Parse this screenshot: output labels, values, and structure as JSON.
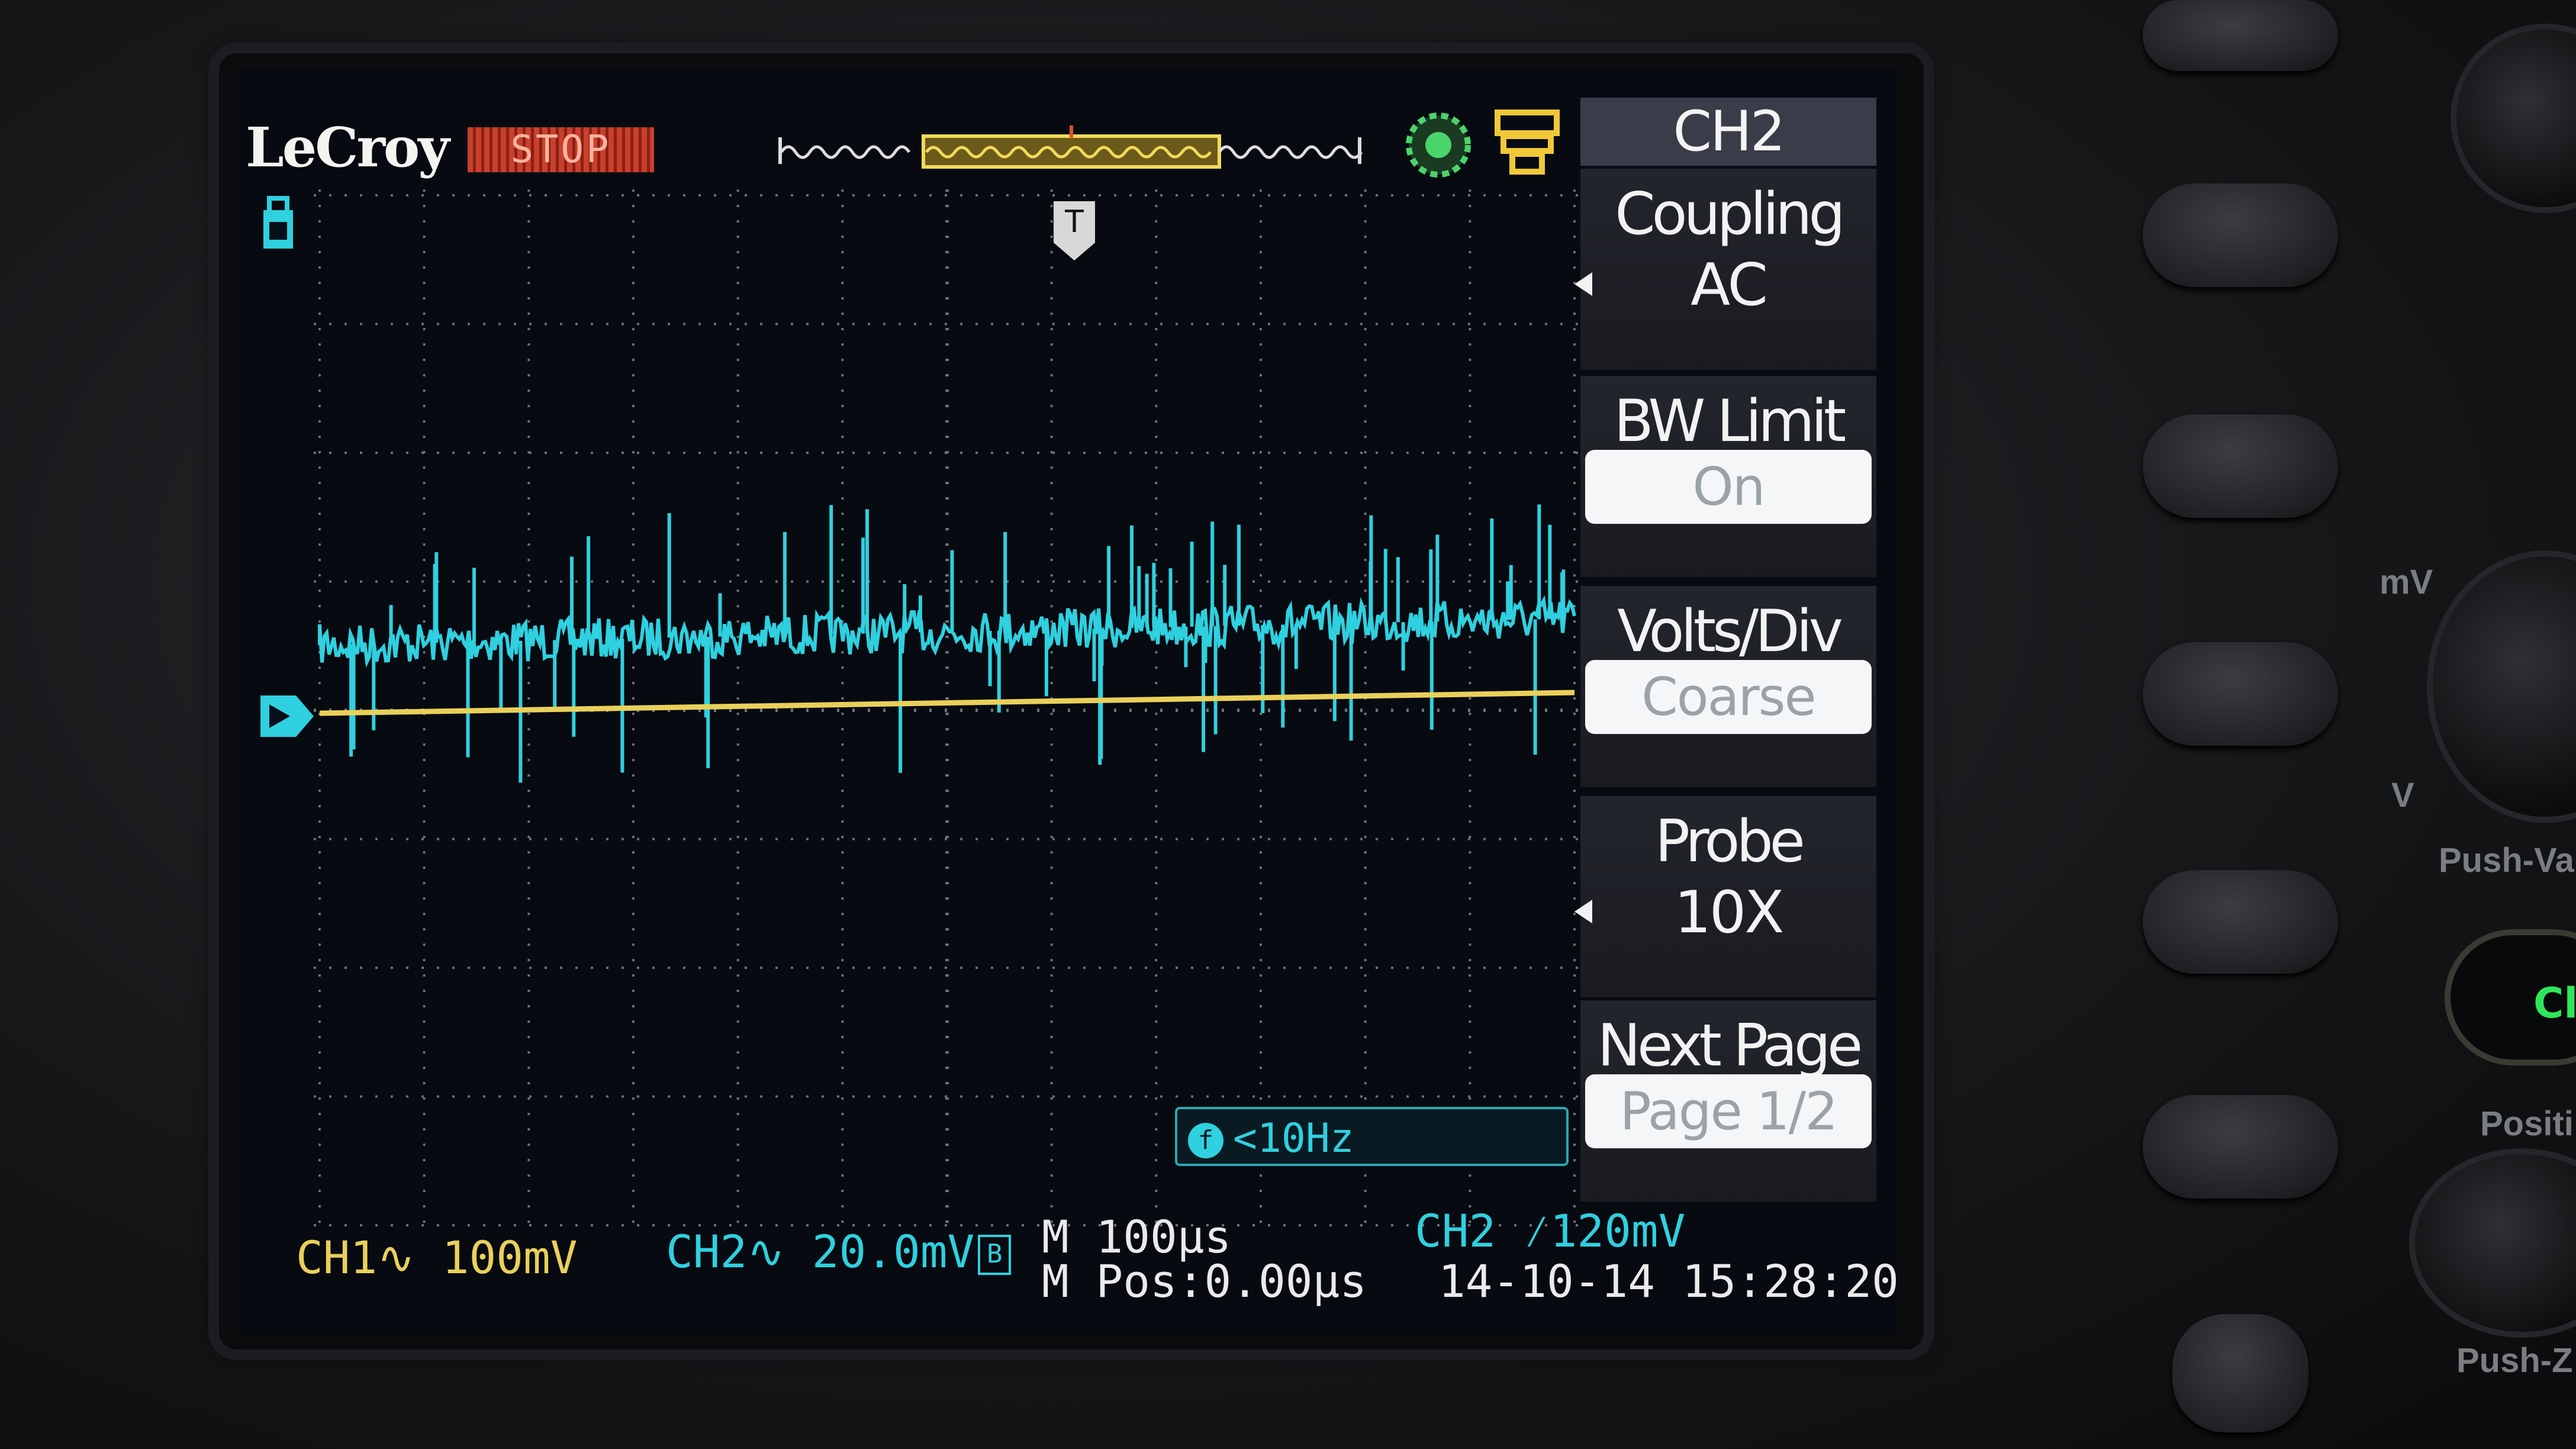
{
  "header": {
    "brand": "LeCroy",
    "run_status": "STOP"
  },
  "menu": {
    "title": "CH2",
    "items": [
      {
        "label": "Coupling",
        "value": "AC",
        "style": "selector"
      },
      {
        "label": "BW Limit",
        "value": "On",
        "style": "pill"
      },
      {
        "label": "Volts/Div",
        "value": "Coarse",
        "style": "pill"
      },
      {
        "label": "Probe",
        "value": "10X",
        "style": "selector"
      },
      {
        "label": "Next Page",
        "value": "Page 1/2",
        "style": "pill"
      }
    ]
  },
  "status": {
    "ch1_scale": "CH1∿ 100mV",
    "ch2_scale": "CH2∿ 20.0mV",
    "ch2_bw_badge": "B",
    "timebase": "M 100μs",
    "mpos": "M Pos:0.00μs",
    "trigger": "CH2 ⁄120mV",
    "datetime": "14-10-14 15:28:20",
    "freq_icon": "f",
    "frequency": "<10Hz",
    "trigger_marker": "T"
  },
  "panel": {
    "knob_label_mv": "mV",
    "knob_label_v": "V",
    "push_label_1": "Push-Va",
    "ch_button": "Cl",
    "position_label": "Positi",
    "push_label_2": "Push-Z"
  },
  "colors": {
    "ch1": "#e9d05a",
    "ch2": "#2fd0df",
    "grid": "#6b6f78"
  }
}
